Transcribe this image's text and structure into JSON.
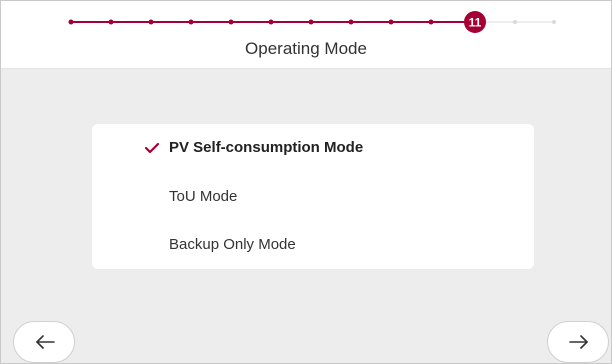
{
  "header": {
    "title": "Operating Mode",
    "stepper": {
      "current_step": "11",
      "completed_steps": 10,
      "remaining_steps": 2,
      "accent_color": "#a50034",
      "inactive_color": "#d9d9d9"
    }
  },
  "mode_options": [
    {
      "label": "PV Self-consumption Mode",
      "selected": true
    },
    {
      "label": "ToU Mode",
      "selected": false
    },
    {
      "label": "Backup Only Mode",
      "selected": false
    }
  ],
  "navigation": {
    "back_icon": "arrow-left-icon",
    "next_icon": "arrow-right-icon"
  }
}
